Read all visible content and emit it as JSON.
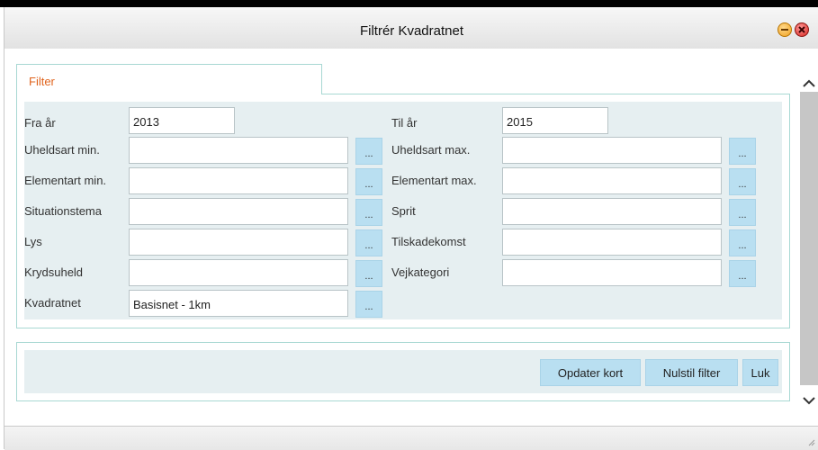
{
  "window": {
    "title": "Filtrér Kvadratnet"
  },
  "tab": {
    "label": "Filter"
  },
  "fields": {
    "fra_aar": {
      "label": "Fra år",
      "value": "2013"
    },
    "til_aar": {
      "label": "Til år",
      "value": "2015"
    },
    "uheldsart_min": {
      "label": "Uheldsart min.",
      "value": ""
    },
    "uheldsart_max": {
      "label": "Uheldsart max.",
      "value": ""
    },
    "elementart_min": {
      "label": "Elementart min.",
      "value": ""
    },
    "elementart_max": {
      "label": "Elementart max.",
      "value": ""
    },
    "situationstema": {
      "label": "Situationstema",
      "value": ""
    },
    "sprit": {
      "label": "Sprit",
      "value": ""
    },
    "lys": {
      "label": "Lys",
      "value": ""
    },
    "tilskadekomst": {
      "label": "Tilskadekomst",
      "value": ""
    },
    "krydsuheld": {
      "label": "Krydsuheld",
      "value": ""
    },
    "vejkategori": {
      "label": "Vejkategori",
      "value": ""
    },
    "kvadratnet": {
      "label": "Kvadratnet",
      "value": "Basisnet - 1km"
    }
  },
  "picker_label": "...",
  "buttons": {
    "update_map": "Opdater kort",
    "reset_filter": "Nulstil filter",
    "close": "Luk"
  },
  "icons": {
    "minimize": "minimize-icon",
    "close": "close-icon",
    "scroll_up": "chevron-up-icon",
    "scroll_down": "chevron-down-icon",
    "resize": "resize-grip-icon"
  }
}
